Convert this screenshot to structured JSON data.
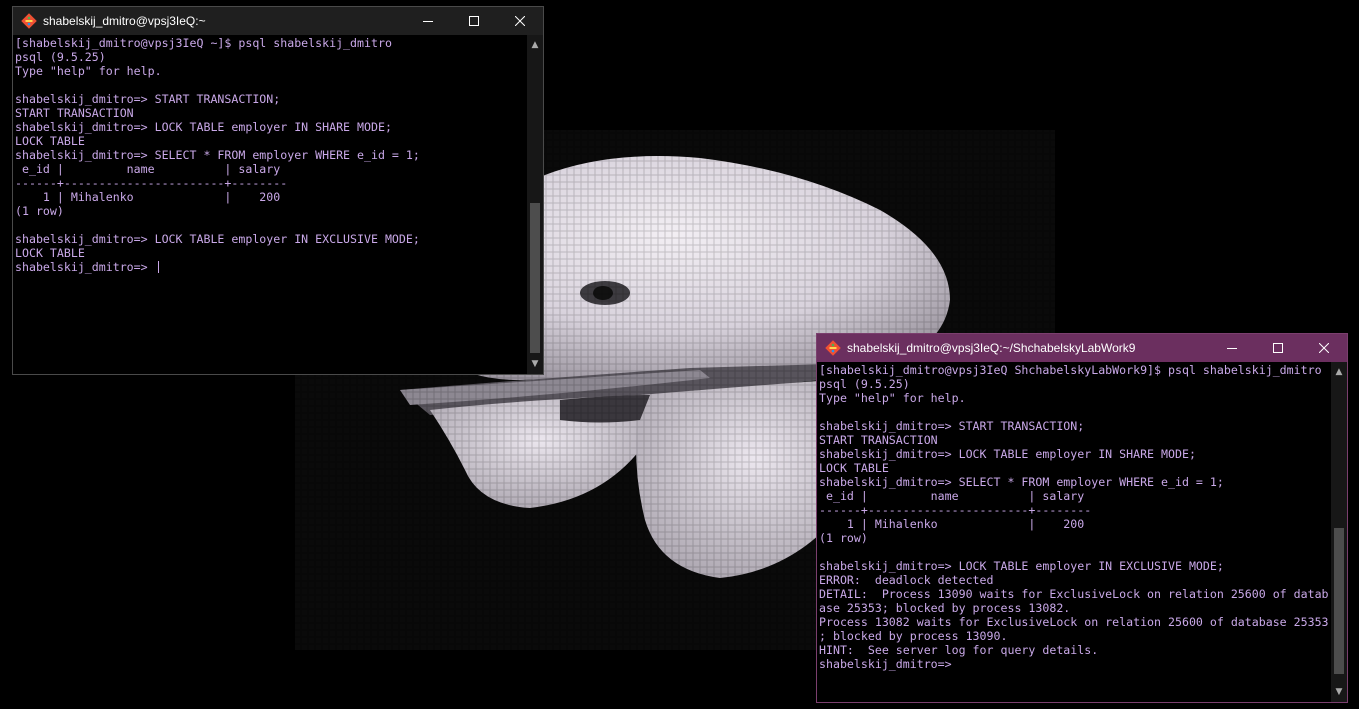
{
  "colors": {
    "terminal_text": "#c9a8e8",
    "terminal_bg": "#000000",
    "active_titlebar": "#6b2f5f",
    "inactive_titlebar": "#1f1f1f"
  },
  "windows": [
    {
      "title": "shabelskij_dmitro@vpsj3IeQ:~",
      "icon": "git-bash-icon",
      "lines": [
        "[shabelskij_dmitro@vpsj3IeQ ~]$ psql shabelskij_dmitro",
        "psql (9.5.25)",
        "Type \"help\" for help.",
        "",
        "shabelskij_dmitro=> START TRANSACTION;",
        "START TRANSACTION",
        "shabelskij_dmitro=> LOCK TABLE employer IN SHARE MODE;",
        "LOCK TABLE",
        "shabelskij_dmitro=> SELECT * FROM employer WHERE e_id = 1;",
        " e_id |         name          | salary",
        "------+-----------------------+--------",
        "    1 | Mihalenko             |    200",
        "(1 row)",
        "",
        "shabelskij_dmitro=> LOCK TABLE employer IN EXCLUSIVE MODE;",
        "LOCK TABLE",
        "shabelskij_dmitro=> "
      ]
    },
    {
      "title": "shabelskij_dmitro@vpsj3IeQ:~/ShchabelskyLabWork9",
      "icon": "git-bash-icon",
      "lines": [
        "[shabelskij_dmitro@vpsj3IeQ ShchabelskyLabWork9]$ psql shabelskij_dmitro",
        "psql (9.5.25)",
        "Type \"help\" for help.",
        "",
        "shabelskij_dmitro=> START TRANSACTION;",
        "START TRANSACTION",
        "shabelskij_dmitro=> LOCK TABLE employer IN SHARE MODE;",
        "LOCK TABLE",
        "shabelskij_dmitro=> SELECT * FROM employer WHERE e_id = 1;",
        " e_id |         name          | salary",
        "------+-----------------------+--------",
        "    1 | Mihalenko             |    200",
        "(1 row)",
        "",
        "shabelskij_dmitro=> LOCK TABLE employer IN EXCLUSIVE MODE;",
        "ERROR:  deadlock detected",
        "DETAIL:  Process 13090 waits for ExclusiveLock on relation 25600 of datab",
        "ase 25353; blocked by process 13082.",
        "Process 13082 waits for ExclusiveLock on relation 25600 of database 25353",
        "; blocked by process 13090.",
        "HINT:  See server log for query details.",
        "shabelskij_dmitro=> "
      ]
    }
  ]
}
